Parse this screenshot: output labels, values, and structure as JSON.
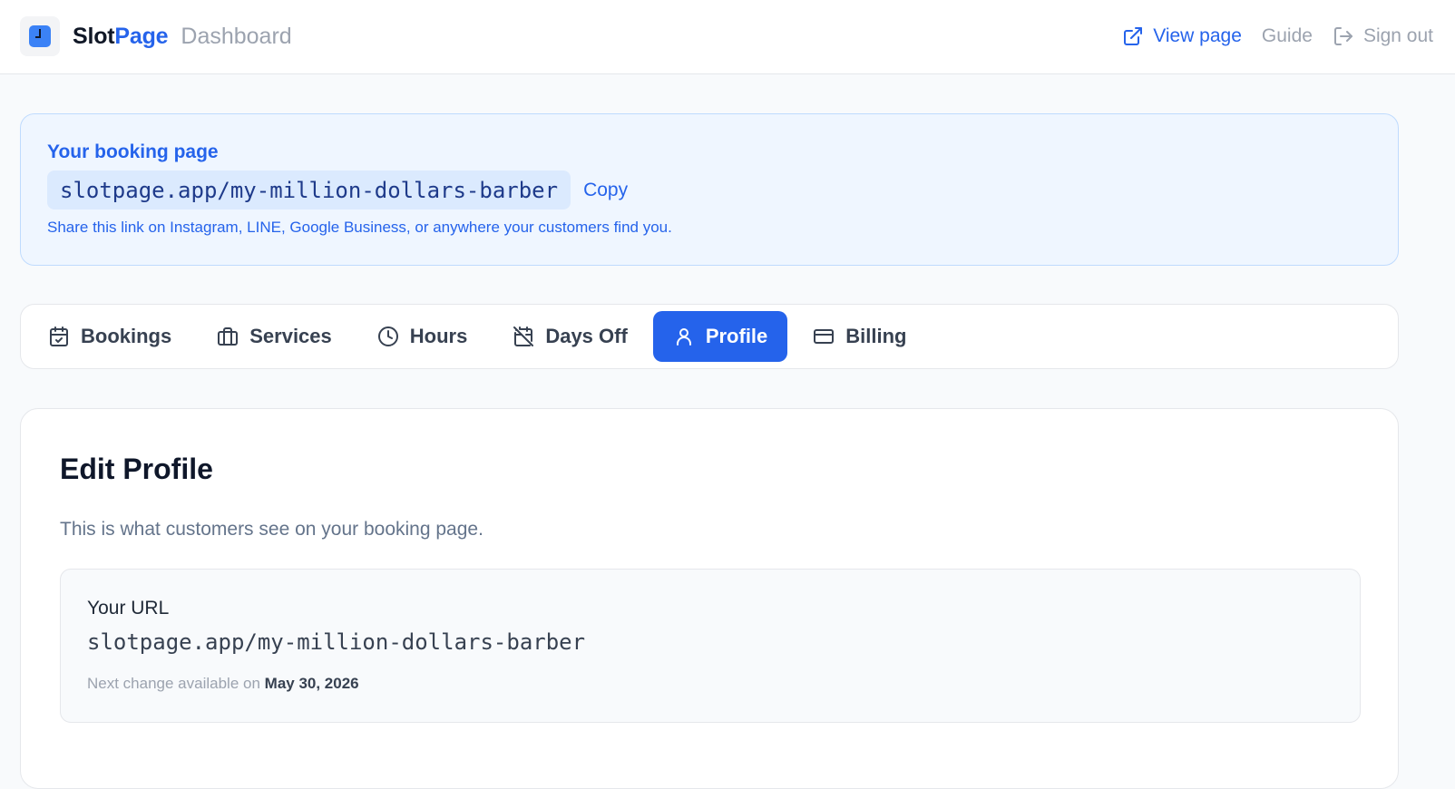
{
  "header": {
    "brand_part1": "Slot",
    "brand_part2": "Page",
    "subtitle": "Dashboard",
    "nav": {
      "view_page": "View page",
      "guide": "Guide",
      "sign_out": "Sign out"
    }
  },
  "banner": {
    "title": "Your booking page",
    "url": "slotpage.app/my-million-dollars-barber",
    "copy_label": "Copy",
    "hint": "Share this link on Instagram, LINE, Google Business, or anywhere your customers find you."
  },
  "tabs": [
    {
      "label": "Bookings",
      "icon": "calendar-check-icon"
    },
    {
      "label": "Services",
      "icon": "briefcase-icon"
    },
    {
      "label": "Hours",
      "icon": "clock-icon"
    },
    {
      "label": "Days Off",
      "icon": "calendar-off-icon"
    },
    {
      "label": "Profile",
      "icon": "user-icon",
      "active": true
    },
    {
      "label": "Billing",
      "icon": "credit-card-icon"
    }
  ],
  "profile": {
    "title": "Edit Profile",
    "subtitle": "This is what customers see on your booking page.",
    "url_label": "Your URL",
    "url_value": "slotpage.app/my-million-dollars-barber",
    "next_change_prefix": "Next change available on",
    "next_change_date": "May 30, 2026"
  },
  "colors": {
    "accent": "#2563eb",
    "banner_bg": "#eff6ff",
    "muted": "#9ca3af"
  }
}
